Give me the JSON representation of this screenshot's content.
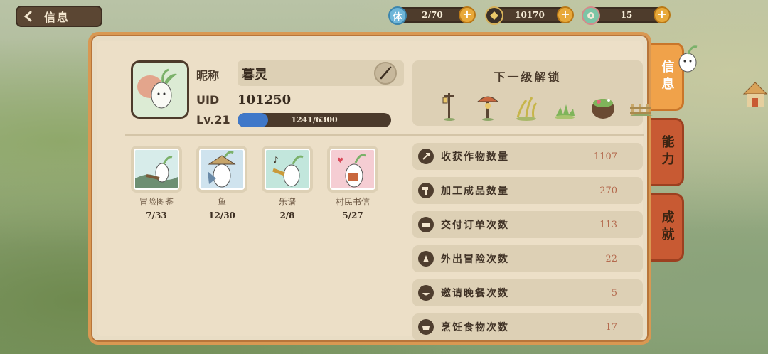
{
  "topbar": {
    "back_label": "信息",
    "stamina": {
      "icon": "体",
      "value": "2/70"
    },
    "coins": {
      "value": "10170"
    },
    "gems": {
      "value": "15"
    }
  },
  "profile": {
    "nickname_label": "昵称",
    "nickname": "暮灵",
    "uid_label": "UID",
    "uid": "101250",
    "level_label": "Lv.21",
    "xp_text": "1241/6300",
    "xp_fraction": 0.197
  },
  "unlock": {
    "title": "下一级解锁",
    "items": [
      "lamp-post-icon",
      "mushroom-lamp-icon",
      "wheat-plant-icon",
      "grass-plant-icon",
      "herb-bowl-icon",
      "fence-icon"
    ]
  },
  "collections": [
    {
      "name": "冒险图鉴",
      "count": "7/33"
    },
    {
      "name": "鱼",
      "count": "12/30"
    },
    {
      "name": "乐谱",
      "count": "2/8"
    },
    {
      "name": "村民书信",
      "count": "5/27"
    }
  ],
  "stats": [
    {
      "label": "收获作物数量",
      "value": "1107",
      "icon": "harvest-icon"
    },
    {
      "label": "加工成品数量",
      "value": "270",
      "icon": "hammer-icon"
    },
    {
      "label": "交付订单次数",
      "value": "113",
      "icon": "order-icon"
    },
    {
      "label": "外出冒险次数",
      "value": "22",
      "icon": "adventure-icon"
    },
    {
      "label": "邀请晚餐次数",
      "value": "5",
      "icon": "dinner-icon"
    },
    {
      "label": "烹饪食物次数",
      "value": "17",
      "icon": "cooking-icon"
    }
  ],
  "tabs": [
    {
      "label": "信息",
      "active": true
    },
    {
      "label": "能力",
      "active": false
    },
    {
      "label": "成就",
      "active": false
    }
  ],
  "colors": {
    "panel_border": "#d99852",
    "tab_active": "#f0a24a",
    "tab_inactive": "#c85a33",
    "xp_fill": "#3f78c9",
    "stat_value": "#b46a4e"
  }
}
